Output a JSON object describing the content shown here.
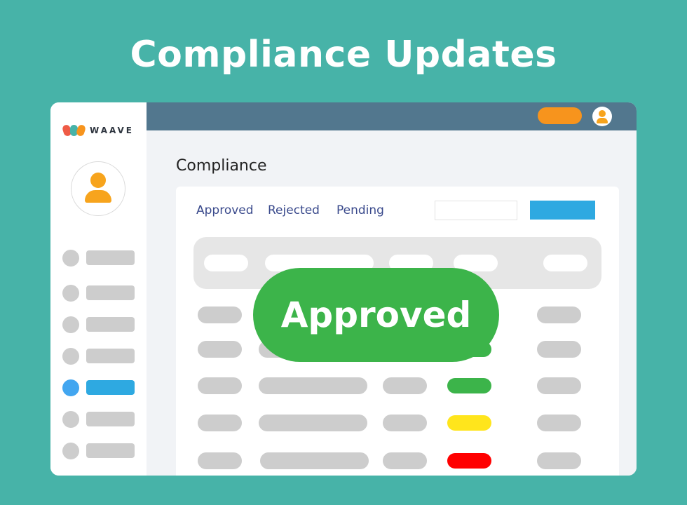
{
  "hero": {
    "title": "Compliance Updates"
  },
  "app": {
    "logo_text": "WAAVE",
    "logo_colors": [
      "#ef5b46",
      "#47b3a8",
      "#f7941d"
    ]
  },
  "header": {
    "pill_color": "#f7941d",
    "avatar_icon": "user-avatar-icon"
  },
  "page": {
    "title": "Compliance"
  },
  "tabs": [
    {
      "label": "Approved"
    },
    {
      "label": "Rejected"
    },
    {
      "label": "Pending"
    }
  ],
  "sidebar": {
    "active_index": 4,
    "items": 7
  },
  "table": {
    "rows": 5,
    "status_colors": [
      "#3cb44a",
      "#3cb44a",
      "#3cb44a",
      "#ffe51c",
      "#ff0000"
    ]
  },
  "badge": {
    "label": "Approved",
    "color": "#3cb44a"
  },
  "colors": {
    "background": "#47b3a8",
    "accent": "#2ea9e1",
    "topbar": "#52778e"
  }
}
